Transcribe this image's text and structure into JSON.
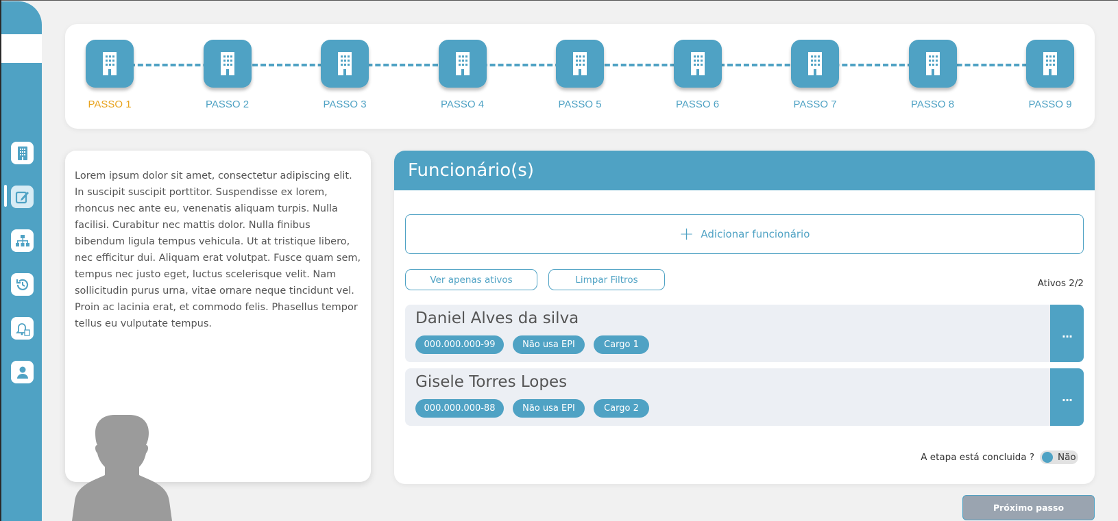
{
  "sidebar": {
    "items": [
      {
        "icon": "building-icon"
      },
      {
        "icon": "edit-icon",
        "active": true
      },
      {
        "icon": "sitemap-icon"
      },
      {
        "icon": "history-icon"
      },
      {
        "icon": "bell-document-icon"
      },
      {
        "icon": "user-icon"
      }
    ]
  },
  "stepper": {
    "steps": [
      {
        "label": "PASSO 1",
        "current": true
      },
      {
        "label": "PASSO 2"
      },
      {
        "label": "PASSO 3"
      },
      {
        "label": "PASSO 4"
      },
      {
        "label": "PASSO 5"
      },
      {
        "label": "PASSO 6"
      },
      {
        "label": "PASSO 7"
      },
      {
        "label": "PASSO 8"
      },
      {
        "label": "PASSO 9"
      }
    ]
  },
  "info": {
    "text": "Lorem ipsum dolor sit amet, consectetur adipiscing elit. In suscipit suscipit porttitor. Suspendisse ex lorem, rhoncus nec ante eu, venenatis aliquam turpis. Nulla facilisi. Curabitur nec mattis dolor. Nulla finibus bibendum ligula tempus vehicula. Ut at tristique libero, nec efficitur dui. Aliquam erat volutpat. Fusce quam sem, tempus nec justo eget, luctus scelerisque velit. Nam sollicitudin purus urna, vitae ornare neque tincidunt vel. Proin ac lacinia erat, et commodo felis. Phasellus tempor tellus eu vulputate tempus."
  },
  "main": {
    "title": "Funcionário(s)",
    "add_label": "Adicionar funcionário",
    "filter_active_label": "Ver apenas ativos",
    "clear_filters_label": "Limpar Filtros",
    "active_count": "Ativos 2/2",
    "employees": [
      {
        "name": "Daniel Alves da silva",
        "cpf": "000.000.000-99",
        "epi": "Não usa EPI",
        "cargo": "Cargo 1",
        "menu": "..."
      },
      {
        "name": "Gisele Torres Lopes",
        "cpf": "000.000.000-88",
        "epi": "Não usa EPI",
        "cargo": "Cargo 2",
        "menu": "..."
      }
    ],
    "concluded_question": "A etapa está concluida ?",
    "concluded_value": "Não"
  },
  "next_button_label": "Próximo passo",
  "colors": {
    "primary": "#4fa2c4",
    "current_step": "#e8a31d",
    "row_bg": "#eceff4",
    "disabled_button": "#9aa4b0"
  }
}
